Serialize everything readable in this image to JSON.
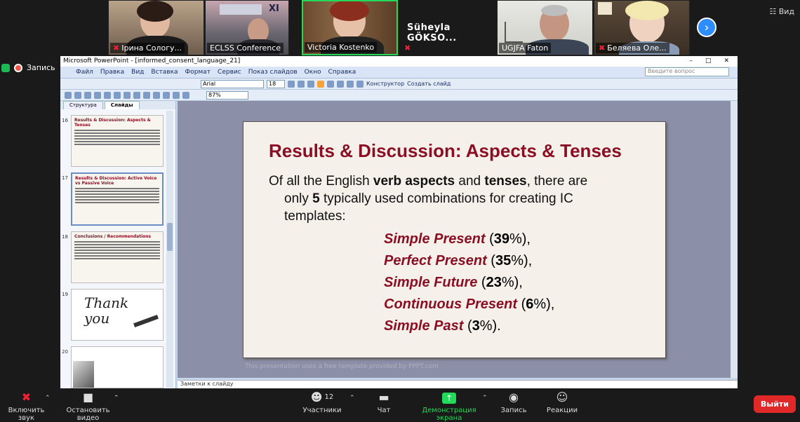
{
  "participants": [
    {
      "name": "Ірина Сологуб",
      "muted": true
    },
    {
      "name": "ECLSS Conference",
      "muted": false,
      "badge": "XI"
    },
    {
      "name": "Victoria Kostenko",
      "muted": false
    },
    {
      "name": "Süheyla GÖKSO...",
      "muted": true
    },
    {
      "name": "UGJFA Faton",
      "muted": false
    },
    {
      "name": "Беляева Оле...",
      "muted": true
    }
  ],
  "participant_labels": [
    "Ірина Сологу...",
    "ECLSS Conference",
    "Victoria Kostenko",
    "Süheyla  GÖKSO...",
    "UGJFA Faton",
    "Беляева Оле..."
  ],
  "view_label": "Вид",
  "recording_label": "Запись",
  "ppt": {
    "window_title": "Microsoft PowerPoint - [informed_consent_language_21]",
    "menu": [
      "Файл",
      "Правка",
      "Вид",
      "Вставка",
      "Формат",
      "Сервис",
      "Показ слайдов",
      "Окно",
      "Справка"
    ],
    "ask_placeholder": "Введите вопрос",
    "font_name": "Arial",
    "font_size": "18",
    "zoom": "87%",
    "designer_label": "Конструктор",
    "new_slide_label": "Создать слайд",
    "tabs": [
      "Структура",
      "Слайды"
    ],
    "thumbnails": [
      {
        "num": "16",
        "title": "Results & Discussion: Aspects & Tenses"
      },
      {
        "num": "17",
        "title": "Results & Discussion: Active Voice vs Passive Voice"
      },
      {
        "num": "18",
        "title": "Conclusions / Recommendations"
      },
      {
        "num": "19",
        "title": "Thank you"
      },
      {
        "num": "20",
        "title": ""
      }
    ],
    "notes_placeholder": "Заметки к слайду"
  },
  "slide": {
    "title": "Results & Discussion: Aspects & Tenses",
    "intro_a": "Of all the English ",
    "intro_b": "verb aspects",
    "intro_c": " and  ",
    "intro_d": "tenses",
    "intro_e": ", there are",
    "intro_f": "only ",
    "intro_g": "5",
    "intro_h": " typically used combinations for creating IC",
    "intro_i": "templates:",
    "items": [
      {
        "term": "Simple Present",
        "pct_open": " (",
        "pct": "39",
        "pct_close": "%),"
      },
      {
        "term": "Perfect Present",
        "pct_open": " (",
        "pct": "35",
        "pct_close": "%),"
      },
      {
        "term": "Simple Future",
        "pct_open": " (",
        "pct": "23",
        "pct_close": "%),"
      },
      {
        "term": "Continuous Present",
        "pct_open": " (",
        "pct": "6",
        "pct_close": "%),"
      },
      {
        "term": "Simple Past",
        "pct_open": " (",
        "pct": "3",
        "pct_close": "%)."
      }
    ],
    "footer": "This presentation uses a free template provided by FPPT.com"
  },
  "bottom": {
    "unmute": "Включить звук",
    "video": "Остановить видео",
    "participants": "Участники",
    "participants_count": "12",
    "chat": "Чат",
    "share": "Демонстрация экрана",
    "record": "Запись",
    "reactions": "Реакции",
    "leave": "Выйти"
  },
  "colors": {
    "accent": "#2d8cff",
    "share": "#23d959",
    "leave": "#e02828",
    "slide_title": "#8b0f24"
  }
}
